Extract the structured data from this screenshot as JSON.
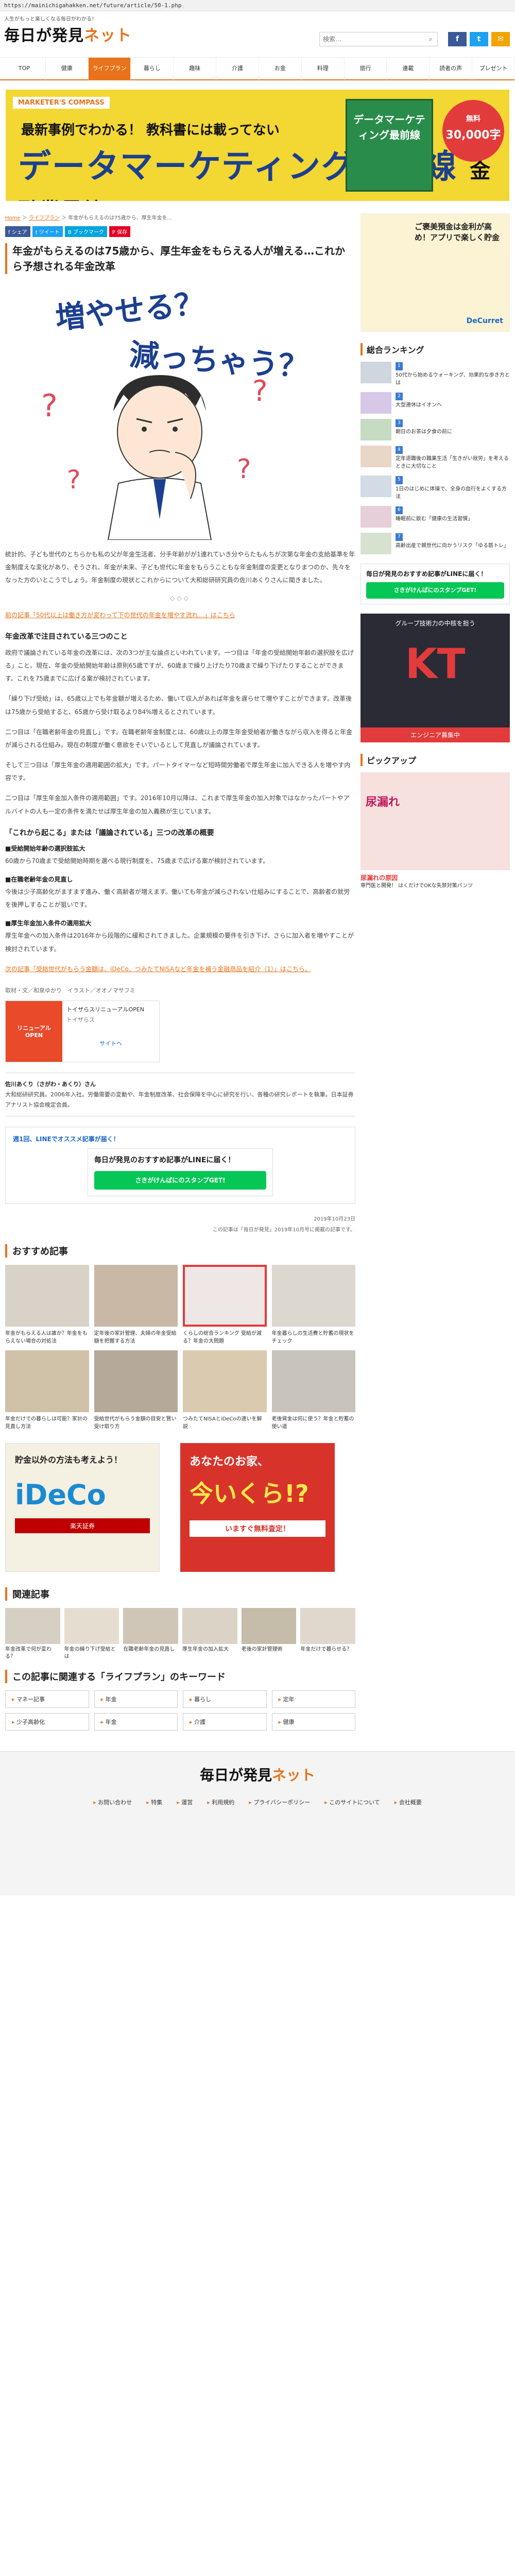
{
  "browser": {
    "url": "https://mainichigahakken.net/future/article/50-1.php"
  },
  "header": {
    "tagline": "人生がもっと楽しくなる毎日がわかる！",
    "logo_main": "毎日が発見",
    "logo_accent": "ネット",
    "search_placeholder": "検索…",
    "social": [
      "f",
      "t",
      "✉"
    ]
  },
  "nav": [
    "TOP",
    "健康",
    "ライフプラン",
    "暮らし",
    "趣味",
    "介護",
    "お金",
    "料理",
    "旅行",
    "連載",
    "読者の声",
    "プレゼント"
  ],
  "banner": {
    "brand": "MARKETER'S COMPASS",
    "sub": "最新事例でわかる！ 教科書には載ってない",
    "title": "データマーケティング最前線",
    "title_small": "金融業界編",
    "book": "データマーケティング最前線",
    "price1": "無料",
    "price2": "30,000字"
  },
  "breadcrumb": {
    "home": "Home",
    "cat": "ライフプラン",
    "current": "年金がもらえるのは75歳から、厚生年金を…"
  },
  "share": [
    "f シェア",
    "t ツイート",
    "B ブックマーク",
    "P 保存"
  ],
  "article": {
    "title": "年金がもらえるのは75歳から、厚生年金をもらえる人が増える…これから予想される年金改革",
    "hero_text_1": "増やせる？",
    "hero_text_2": "減っちゃう？",
    "p1": "統計的、子ども世代のとちらかも私の父が年金生活者、分手年齢がが1連れていき分やらたもんちが次第な年金の支給基準を年金制度えな変化があり、そうされ、年金が未来、子ども世代に年金をもらうこともな年金制度の変更となりまつのか、先々をなった方のいとこうでしょう。年金制度の現状とこれからについて大和総研研究員の佐川あくりさんに聞きました。",
    "divider": "◇◇◇",
    "link1": "前の記事「50代以上は働き方が変わって下の世代の年金を増やす流れ…」はこちら",
    "h_main": "年金改革で注目されている三つのこと",
    "p2": "政府で議論されている年金の改革には、次の3つが主な論点といわれています。一つ目は「年金の受給開始年齢の選択肢を広げる」こと。現在、年金の受給開始年齢は原則65歳ですが、60歳まで繰り上げたり70歳まで繰り下げたりすることができます。これを75歳までに広げる案が検討されています。",
    "p3": "「繰り下げ受給」は、65歳以上でも年金額が増えるため、働いて収入があれば年金を遅らせて増やすことができます。改革後は75歳から受給すると、65歳から受け取るより84%増えるとされています。",
    "p4": "二つ目は「在職老齢年金の見直し」です。在職老齢年金制度とは、60歳以上の厚生年金受給者が働きながら収入を得ると年金が減らされる仕組み。現在の制度が働く意欲をそいでいるとして見直しが議論されています。",
    "p5": "そして三つ目は「厚生年金の適用範囲の拡大」です。パートタイマーなど短時間労働者で厚生年金に加入できる人を増やす内容です。",
    "p6": "二つ目は「厚生年金加入条件の適用範囲」です。2016年10月以降は、これまで厚生年金の加入対象ではなかったパートやアルバイトの人も一定の条件を満たせば厚生年金の加入義務が生じています。",
    "h_sub": "「これから起こる」または「議論されている」三つの改革の概要",
    "h3a": "■受給開始年齢の選択肢拡大",
    "p7": "60歳から70歳まで受給開始時期を選べる現行制度を、75歳まで広げる案が検討されています。",
    "h3b": "■在職老齢年金の見直し",
    "p8": "今後は少子高齢化がますます進み、働く高齢者が増えます。働いても年金が減らされない仕組みにすることで、高齢者の就労を後押しすることが狙いです。",
    "h3c": "■厚生年金加入条件の適用拡大",
    "p9": "厚生年金への加入条件は2016年から段階的に緩和されてきました。企業規模の要件を引き下げ、さらに加入者を増やすことが検討されています。",
    "link2": "次の記事「受給世代がもらう金額は、iDeCo、つみたてNISAなど年金を補う金融商品を紹介（1）」はこちら。"
  },
  "credit": "取材・文／和泉ゆかり　イラスト／オオノマサフミ",
  "ad_small": {
    "img": "リニューアルOPEN",
    "title": "トイザらスリニューアルOPEN",
    "brand": "トイザらス",
    "link": "サイトへ"
  },
  "author": {
    "name": "佐川あくり（さがわ・あくり）さん",
    "desc": "大和総研研究員。2006年入社。労働需要の変動や、年金制度改革、社会保障を中心に研究を行い、各種の研究レポートを執筆。日本証券アナリスト協会検定会員。"
  },
  "line_box": {
    "head": "週1回、LINEでオススメ記事が届く！",
    "title": "毎日が発見のおすすめ記事がLINEに届く！",
    "button": "さきがけんぱにのスタンプGET!"
  },
  "meta": {
    "date": "2019年10月23日",
    "note": "この記事は「毎日が発見」2019年10月号に掲載の記事です。"
  },
  "recommend": {
    "title": "おすすめ記事",
    "items": [
      "年金がもらえる人は誰か？年金をもらえない場合の対処法",
      "定年後の家計管理、夫婦の年金受給額を把握する方法",
      "くらしの総合ランキング 受給が減る？年金の大問題",
      "年金暮らしの生活費と貯蓄の現状をチェック",
      "年金だけでの暮らしは可能？家計の見直し方法",
      "受給世代がもらう金額の目安と賢い受け取り方",
      "つみたてNISAとiDeCoの違いを解説",
      "老後資金は何に使う？年金と貯蓄の使い道"
    ]
  },
  "ads_big": {
    "ideco": {
      "t1": "貯金以外の方法も考えよう！",
      "t2": "iDeCo",
      "t3": "楽天証券"
    },
    "house": {
      "t1": "あなたのお家、",
      "t2": "今いくら!?",
      "t3": "いますぐ無料査定！"
    }
  },
  "related": {
    "title": "関連記事",
    "items": [
      "年金改革で何が変わる？",
      "年金の繰り下げ受給とは",
      "在職老齢年金の見直し",
      "厚生年金の加入拡大",
      "老後の家計管理術",
      "年金だけで暮らせる？"
    ]
  },
  "keywords": {
    "title": "この記事に関連する「ライフプラン」のキーワード",
    "items": [
      "マネー記事",
      "年金",
      "暮らし",
      "定年",
      "少子高齢化",
      "年金",
      "介護",
      "健康"
    ]
  },
  "side": {
    "ad1": {
      "t1": "ご褒美預金は金利が高め！アプリで楽しく貯金",
      "logo": "DeCurret"
    },
    "ranking_title": "総合ランキング",
    "ranking": [
      {
        "num": "1",
        "text": "50代から始めるウォーキング、効果的な歩き方とは"
      },
      {
        "num": "2",
        "text": "大型連休はイオンへ"
      },
      {
        "num": "3",
        "text": "朝日のお茶は夕食の前に"
      },
      {
        "num": "4",
        "text": "定年退職後の職業生活「生きがい就労」を考えるときに大切なこと"
      },
      {
        "num": "5",
        "text": "1日のはじめに体操で、全身の血行をよくする方法"
      },
      {
        "num": "6",
        "text": "睡眠前に飲む「健康の生活習慣」"
      },
      {
        "num": "7",
        "text": "高齢出産で親世代に向かうリスク「ゆる筋トレ」"
      }
    ],
    "line": {
      "t1": "毎日が発見のおすすめ記事がLINEに届く！",
      "btn": "さきがけんぱにのスタンプGET!"
    },
    "kt": {
      "t1": "グループ技術力の中核を担う",
      "t2": "KT",
      "t3": "エンジニア募集中"
    },
    "pickup_title": "ピックアップ",
    "pickup": {
      "img": "尿漏れ",
      "cap": "尿漏れの原因",
      "desc": "専門医と開発！ はくだけでOKな失禁対策パンツ"
    }
  },
  "footer": {
    "logo_main": "毎日が発見",
    "logo_accent": "ネット",
    "links": [
      "お問い合わせ",
      "特集",
      "運営",
      "利用規約",
      "プライバシーポリシー",
      "このサイトについて",
      "会社概要"
    ]
  }
}
